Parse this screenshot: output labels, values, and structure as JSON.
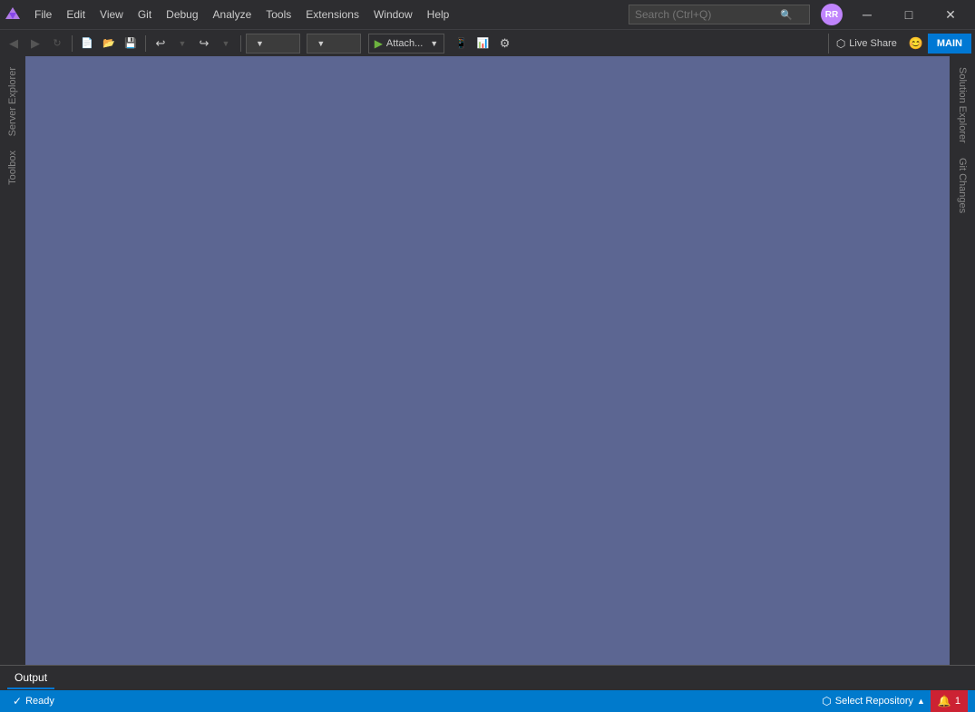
{
  "titlebar": {
    "menu": [
      {
        "label": "File",
        "id": "file"
      },
      {
        "label": "Edit",
        "id": "edit"
      },
      {
        "label": "View",
        "id": "view"
      },
      {
        "label": "Git",
        "id": "git"
      },
      {
        "label": "Debug",
        "id": "debug"
      },
      {
        "label": "Analyze",
        "id": "analyze"
      },
      {
        "label": "Tools",
        "id": "tools"
      },
      {
        "label": "Extensions",
        "id": "extensions"
      },
      {
        "label": "Window",
        "id": "window"
      },
      {
        "label": "Help",
        "id": "help"
      }
    ],
    "search_placeholder": "Search (Ctrl+Q)",
    "user_initials": "RR",
    "window_controls": {
      "minimize": "─",
      "restore": "□",
      "close": "✕"
    }
  },
  "toolbar": {
    "undo_label": "↩",
    "redo_label": "↪",
    "attach_label": "Attach...",
    "liveshare_label": "Live Share",
    "main_label": "MAIN",
    "dropdown1_placeholder": "",
    "dropdown2_placeholder": ""
  },
  "left_sidebar": {
    "tabs": [
      {
        "label": "Server Explorer",
        "id": "server-explorer"
      },
      {
        "label": "Toolbox",
        "id": "toolbox"
      }
    ]
  },
  "right_sidebar": {
    "tabs": [
      {
        "label": "Solution Explorer",
        "id": "solution-explorer"
      },
      {
        "label": "Git Changes",
        "id": "git-changes"
      }
    ]
  },
  "bottom_panel": {
    "tabs": [
      {
        "label": "Output",
        "id": "output",
        "active": true
      }
    ]
  },
  "statusbar": {
    "ready_label": "Ready",
    "repo_label": "Select Repository",
    "error_count": "1"
  }
}
